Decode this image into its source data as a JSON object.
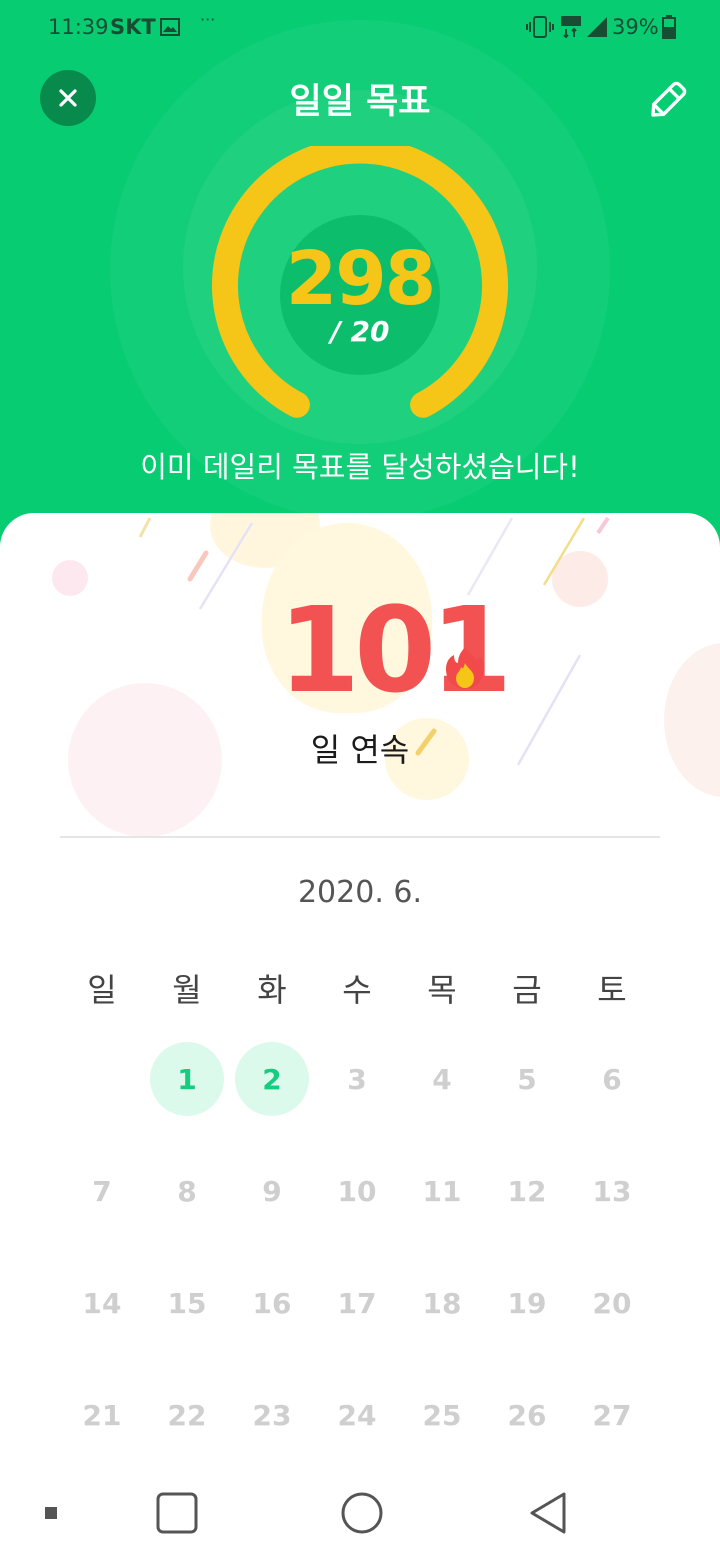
{
  "status_bar": {
    "time": "11:39",
    "carrier": "SKT",
    "dots": "···",
    "network": "LTE",
    "battery": "39%"
  },
  "header": {
    "title": "일일 목표",
    "progress_value": "298",
    "progress_goal": "/ 20",
    "message": "이미 데일리 목표를 달성하셨습니다!",
    "accent_color": "#07cc72",
    "ring_color": "#f5c518"
  },
  "streak": {
    "count": "101",
    "label": "일 연속"
  },
  "calendar": {
    "month_label": "2020. 6.",
    "weekdays": [
      "일",
      "월",
      "화",
      "수",
      "목",
      "금",
      "토"
    ],
    "days": [
      "1",
      "2",
      "3",
      "4",
      "5",
      "6",
      "7",
      "8",
      "9",
      "10",
      "11",
      "12",
      "13",
      "14",
      "15",
      "16",
      "17",
      "18",
      "19",
      "20",
      "21",
      "22",
      "23",
      "24",
      "25",
      "26",
      "27"
    ],
    "completed_days": [
      "1",
      "2"
    ]
  },
  "icons": {
    "close": "close-icon",
    "edit": "pencil-icon",
    "flame": "flame-icon",
    "nav": [
      "menu-square-icon",
      "recents-icon",
      "home-icon",
      "back-icon"
    ]
  }
}
